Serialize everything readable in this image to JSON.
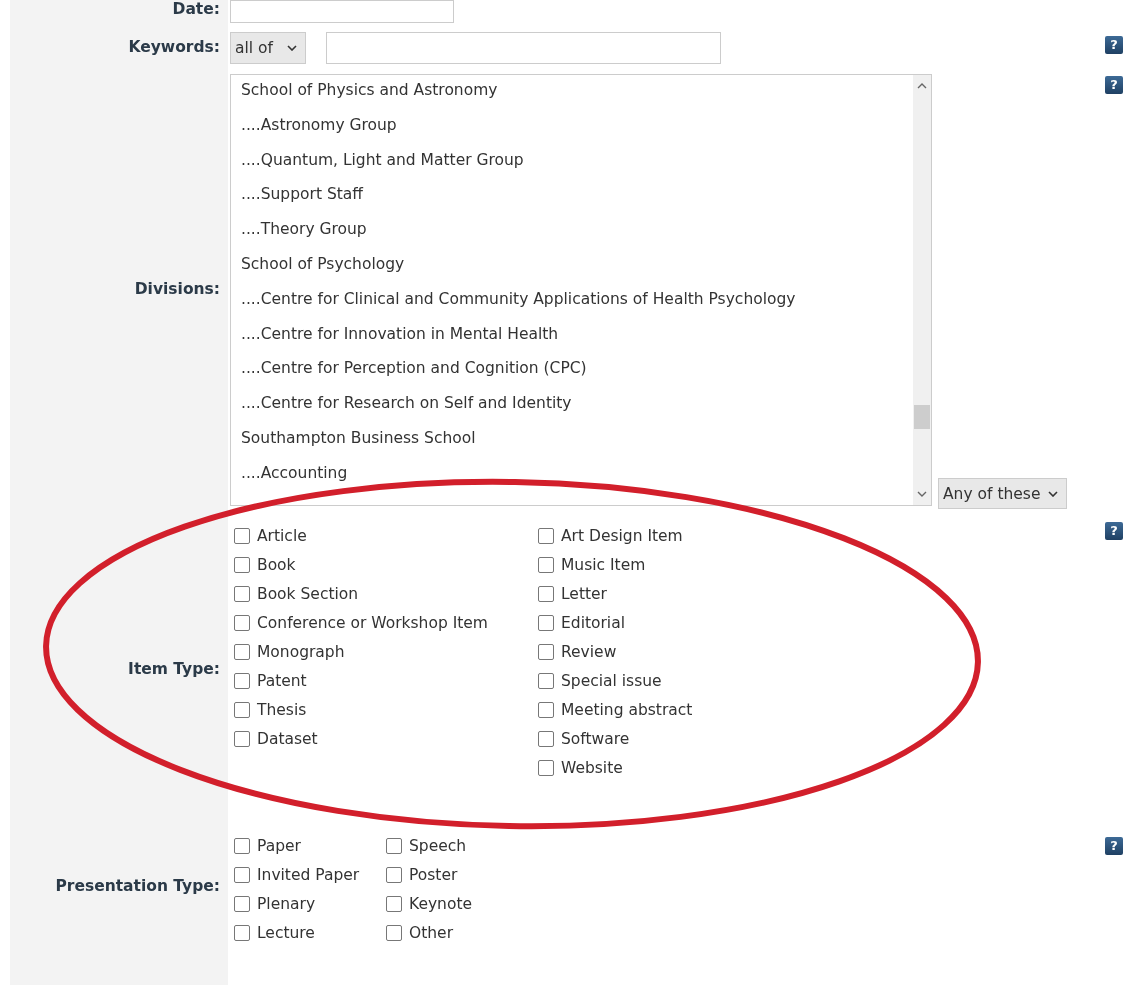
{
  "date": {
    "label": "Date:"
  },
  "keywords": {
    "label": "Keywords:",
    "mode": "all of",
    "help": "?"
  },
  "divisions": {
    "label": "Divisions:",
    "help": "?",
    "match": "Any of these",
    "items": [
      {
        "text": "School of Physics and Astronomy",
        "selected": false
      },
      {
        "text": "....Astronomy Group",
        "selected": false
      },
      {
        "text": "....Quantum, Light and Matter Group",
        "selected": false
      },
      {
        "text": "....Support Staff",
        "selected": false
      },
      {
        "text": "....Theory Group",
        "selected": false
      },
      {
        "text": "School of Psychology",
        "selected": false
      },
      {
        "text": "....Centre for Clinical and Community Applications of Health Psychology",
        "selected": false
      },
      {
        "text": "....Centre for Innovation in Mental Health",
        "selected": false
      },
      {
        "text": "....Centre for Perception and Cognition (CPC)",
        "selected": false
      },
      {
        "text": "....Centre for Research on Self and Identity",
        "selected": false
      },
      {
        "text": "Southampton Business School",
        "selected": false
      },
      {
        "text": "....Accounting",
        "selected": false
      }
    ]
  },
  "item_type": {
    "label": "Item Type:",
    "help": "?",
    "columns": [
      [
        {
          "text": "Article",
          "checked": false
        },
        {
          "text": "Book",
          "checked": false
        },
        {
          "text": "Book Section",
          "checked": false
        },
        {
          "text": "Conference or Workshop Item",
          "checked": false
        },
        {
          "text": "Monograph",
          "checked": false
        },
        {
          "text": "Patent",
          "checked": false
        },
        {
          "text": "Thesis",
          "checked": false
        },
        {
          "text": "Dataset",
          "checked": false
        }
      ],
      [
        {
          "text": "Art Design Item",
          "checked": false
        },
        {
          "text": "Music Item",
          "checked": false
        },
        {
          "text": "Letter",
          "checked": false
        },
        {
          "text": "Editorial",
          "checked": false
        },
        {
          "text": "Review",
          "checked": false
        },
        {
          "text": "Special issue",
          "checked": false
        },
        {
          "text": "Meeting abstract",
          "checked": false
        },
        {
          "text": "Software",
          "checked": false
        },
        {
          "text": "Website",
          "checked": false
        }
      ]
    ]
  },
  "presentation_type": {
    "label": "Presentation Type:",
    "help": "?",
    "columns": [
      [
        {
          "text": "Paper",
          "checked": false
        },
        {
          "text": "Invited Paper",
          "checked": false
        },
        {
          "text": "Plenary",
          "checked": false
        },
        {
          "text": "Lecture",
          "checked": false
        }
      ],
      [
        {
          "text": "Speech",
          "checked": false
        },
        {
          "text": "Poster",
          "checked": false
        },
        {
          "text": "Keynote",
          "checked": false
        },
        {
          "text": "Other",
          "checked": false
        }
      ]
    ]
  }
}
